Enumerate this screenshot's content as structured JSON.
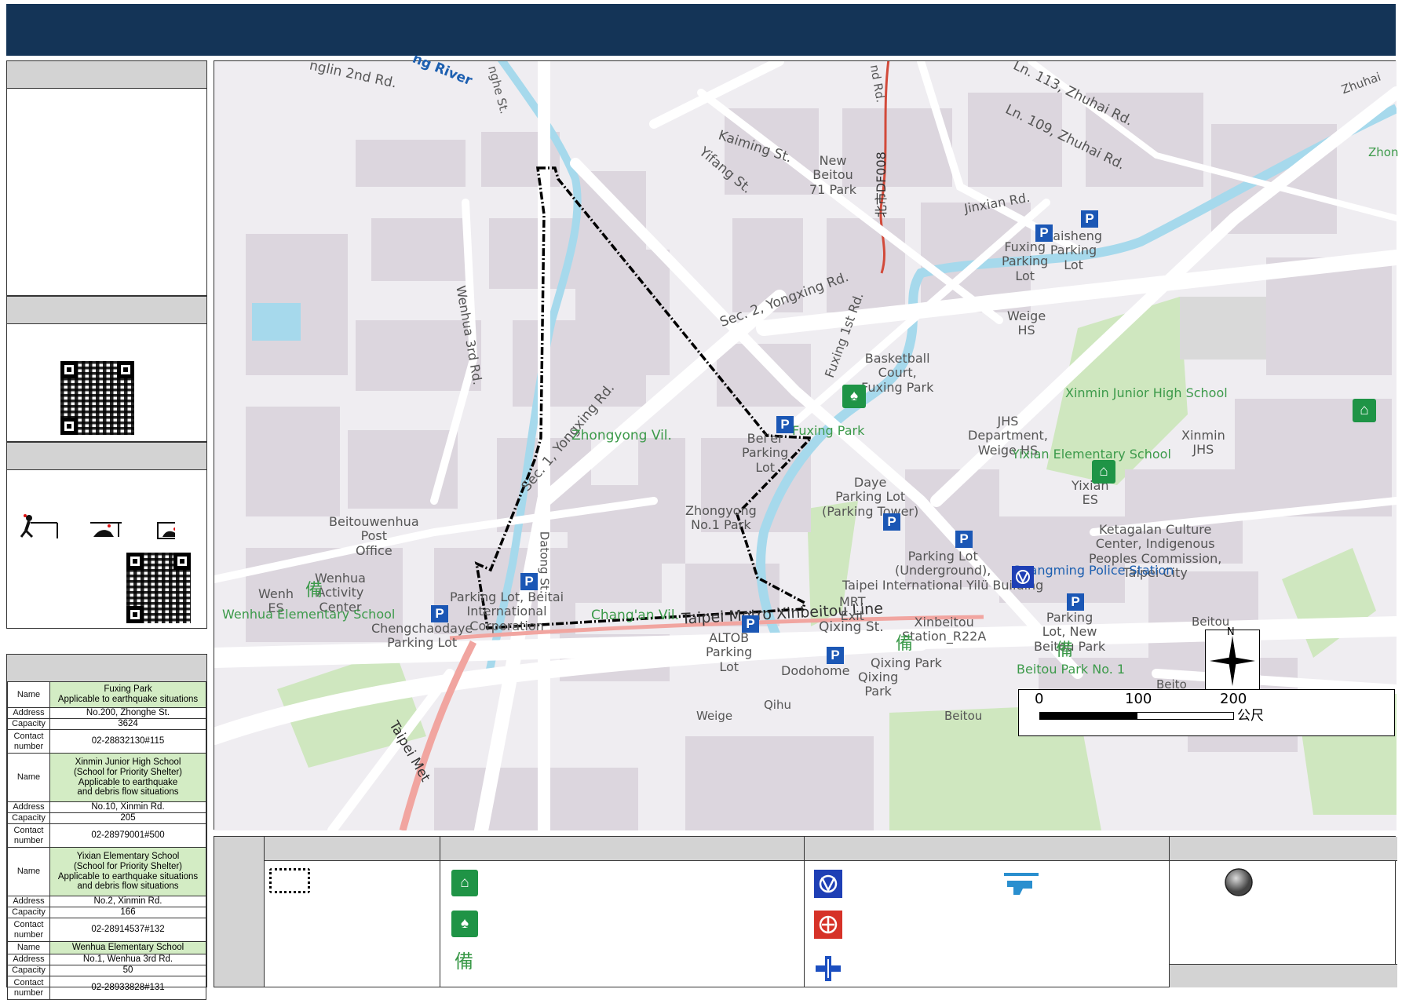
{
  "title": "",
  "side_panels": {
    "overview_head": "",
    "qr_head": "",
    "safety_head": "",
    "shelters_head": ""
  },
  "shelters": [
    {
      "name_label": "Name",
      "name": "Fuxing Park\nApplicable to earthquake situations",
      "address_label": "Address",
      "address": "No.200, Zhonghe St.",
      "capacity_label": "Capacity",
      "capacity": "3624",
      "contact_label": "Contact number",
      "contact": "02-28832130#115"
    },
    {
      "name_label": "Name",
      "name": "Xinmin Junior High School\n(School for Priority Shelter)\nApplicable to earthquake\nand debris flow situations",
      "address_label": "Address",
      "address": "No.10, Xinmin Rd.",
      "capacity_label": "Capacity",
      "capacity": "205",
      "contact_label": "Contact number",
      "contact": "02-28979001#500"
    },
    {
      "name_label": "Name",
      "name": "Yixian Elementary School\n(School for Priority Shelter)\nApplicable to earthquake situations\nand debris flow situations",
      "address_label": "Address",
      "address": "No.2, Xinmin Rd.",
      "capacity_label": "Capacity",
      "capacity": "166",
      "contact_label": "Contact number",
      "contact": "02-28914537#132"
    },
    {
      "name_label": "Name",
      "name": "Wenhua Elementary School",
      "address_label": "Address",
      "address": "No.1, Wenhua 3rd Rd.",
      "capacity_label": "Capacity",
      "capacity": "50",
      "contact_label": "Contact number",
      "contact": "02-28933828#131"
    }
  ],
  "map": {
    "roads": {
      "r1": "nglin 2nd Rd.",
      "r2": "ng River",
      "r3": "nghe St.",
      "r4": "nd Rd.",
      "r5": "Ln. 113, Zhuhai Rd.",
      "r6": "Ln. 109, Zhuhai Rd.",
      "r7": "Zhuhai",
      "r8": "Kaiming St.",
      "r9": "Yifang St.",
      "r10": "北市DF008",
      "r11": "Jinxian Rd.",
      "r12": "Sec. 2, Yongxing Rd.",
      "r13": "Fuxing 1st Rd.",
      "r14": "Wenhua 3rd Rd.",
      "r15": "Sec. 1, Yongxing Rd.",
      "r16": "Datong St.",
      "r17": "Taipei Metro Xinbeitou Line",
      "r18": "Qixing St.",
      "r19": "Taipei Met"
    },
    "villages": {
      "v1": "Zhongyong Vil.",
      "v2": "Chang'an Vil."
    },
    "pois": {
      "p1": "New\nBeitou\n71 Park",
      "p2": "Zhon",
      "p3": "Fuxing\nParking\nLot",
      "p4": "Kaisheng\nParking\nLot",
      "p5": "Weige\nHS",
      "p6": "Basketball\nCourt,\nFuxing Park",
      "p7": "JHS\nDepartment,\nWeige HS",
      "p8": "Bei'er\nParking\nLot",
      "p9": "Fuxing Park",
      "p10": "Xinmin Junior High School",
      "p11": "Xinmin\nJHS",
      "p12": "Yixian Elementary School",
      "p13": "Yixian\nES",
      "p14": "Daye\nParking Lot\n(Parking Tower)",
      "p15": "Zhongyong\nNo.1 Park",
      "p16": "Ketagalan Culture\nCenter, Indigenous\nPeoples Commission,\nTaipei City",
      "p17": "Beitouwenhua\nPost\nOffice",
      "p18": "Wenhua\nActivity\nCenter",
      "p19": "Wenh\nES",
      "p20": "Wenhua Elementary School",
      "p21": "Parking Lot, Beitai\nInternational\nCorporation",
      "p22": "Parking Lot\n(Underground),\nTaipei International Yilü Building",
      "p23": "Guangming Police Station",
      "p24": "MRT\nExit",
      "p25": "Xinbeitou\nStation_R22A",
      "p26": "Chengchaodaye\nParking Lot",
      "p27": "ALTOB\nParking\nLot",
      "p28": "Dodohome",
      "p29": "Qixing Park",
      "p30": "Qixing\nPark",
      "p31": "Parking\nLot, New\nBeitou Park",
      "p32": "Beitou Park No. 1",
      "p33": "Beitou",
      "p34": "Beito",
      "p35": "Weige",
      "p36": "Qihu",
      "p37": "Beitou"
    },
    "scale": {
      "t0": "0",
      "t1": "100",
      "t2": "200",
      "unit": "公尺"
    },
    "north": "N",
    "prep_char": "備"
  },
  "legend": {
    "side_head": "",
    "col1_head": "",
    "col2_head": "",
    "col3_head": "",
    "col4_head": "",
    "icons": [
      "evacuation-boundary",
      "school-shelter",
      "park-shelter",
      "reserve-shelter",
      "police-station",
      "fire-station",
      "medical",
      "helicopter",
      "meeting-point"
    ]
  },
  "colors": {
    "title_bar": "#143457",
    "panel_head": "#d3d3d3",
    "highlight": "#d3ecc4",
    "parking": "#1b57b5",
    "shelter_green": "#1f9446",
    "river": "#a6d9ec",
    "road": "#ffffff",
    "block": "#dcd6de"
  }
}
